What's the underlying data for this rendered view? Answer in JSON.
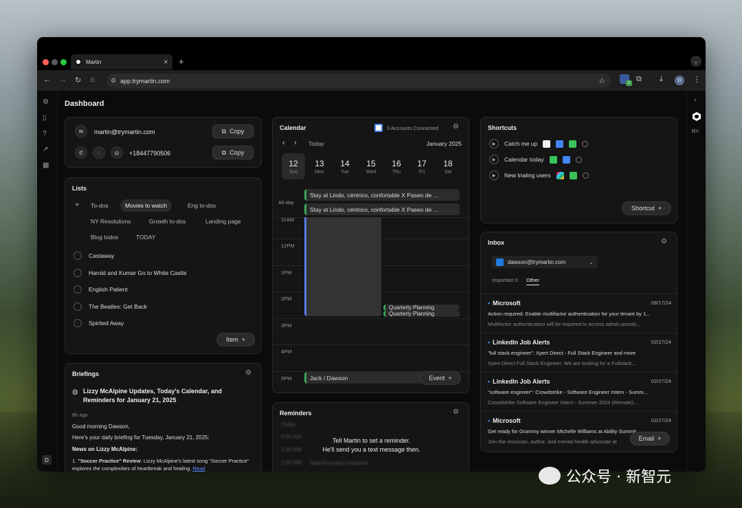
{
  "browser": {
    "tab_title": "Martin",
    "url": "app.trymartin.com",
    "ext_badge": "2",
    "profile": "D"
  },
  "page": {
    "title": "Dashboard",
    "user_initial": "D",
    "shortcut_hint": "⌘K"
  },
  "contact": {
    "email": "martin@trymartin.com",
    "phone": "+18447790506",
    "copy_label": "Copy"
  },
  "lists": {
    "title": "Lists",
    "tabs": [
      "To-dos",
      "Movies to watch",
      "Eng to-dos",
      "NY Resolutions",
      "Growth to-dos",
      "Landing page",
      "Blog todos",
      "TODAY"
    ],
    "active_tab": "Movies to watch",
    "items": [
      "Castaway",
      "Harold and Kumar Go to White Castle",
      "English Patient",
      "The Beatles: Get Back",
      "Spirited Away"
    ],
    "add_label": "Item"
  },
  "briefings": {
    "title": "Briefings",
    "headline": "Lizzy McAlpine Updates, Today's Calendar, and Reminders for January 21, 2025",
    "time": "8h ago",
    "greeting": "Good morning Dawson,",
    "intro": "Here's your daily briefing for Tuesday, January 21, 2025:",
    "section": "News on Lizzy McAlpine:",
    "item_title": "\"Soccer Practice\" Review",
    "item_text": ": Lizzy McAlpine's latest song \"Soccer Practice\" explores the complexities of heartbreak and healing.",
    "read_link": "Read"
  },
  "calendar": {
    "title": "Calendar",
    "accounts": "3 Accounts Connected",
    "today_label": "Today",
    "month": "January 2025",
    "days": [
      {
        "num": "12",
        "wd": "Sun"
      },
      {
        "num": "13",
        "wd": "Mon"
      },
      {
        "num": "14",
        "wd": "Tue"
      },
      {
        "num": "15",
        "wd": "Wed"
      },
      {
        "num": "16",
        "wd": "Thu"
      },
      {
        "num": "17",
        "wd": "Fri"
      },
      {
        "num": "18",
        "wd": "Sat"
      }
    ],
    "all_day_label": "All-day",
    "all_day_events": [
      "Stay at Lindo, céntrico, confortable X Paseo de ...",
      "Stay at Lindo, céntrico, confortable X Paseo de ..."
    ],
    "hours": [
      "11AM",
      "12PM",
      "1PM",
      "2PM",
      "3PM",
      "4PM",
      "5PM"
    ],
    "events": [
      "Quarterly Planning",
      "Quarterly Planning",
      "Jack / Dawson"
    ],
    "add_label": "Event"
  },
  "reminders": {
    "title": "Reminders",
    "empty_line1": "Tell Martin to set a reminder.",
    "empty_line2": "He'll send you a text message then.",
    "ghost": [
      "Today",
      "9:00 AM",
      "2:30 PM",
      "5:00 PM",
      "Submit project proposal"
    ]
  },
  "shortcuts": {
    "title": "Shortcuts",
    "items": [
      "Catch me up",
      "Calendar today",
      "New trialing users"
    ],
    "add_label": "Shortcut"
  },
  "inbox": {
    "title": "Inbox",
    "account": "dawson@trymartin.com",
    "tabs": [
      "Important 0",
      "Other"
    ],
    "active_tab": "Other",
    "mails": [
      {
        "from": "Microsoft",
        "date": "08/17/24",
        "subject": "Action required: Enable multifactor authentication for your tenant by 1...",
        "preview": "Multifactor authentication will be required to access admin portals..."
      },
      {
        "from": "LinkedIn Job Alerts",
        "date": "02/27/24",
        "subject": "\"full stack engineer\": Xpert Direct - Full Stack Engineer and more",
        "preview": "Xpert Direct Full Stack Engineer: We are looking for a Fullstack..."
      },
      {
        "from": "LinkedIn Job Alerts",
        "date": "02/27/24",
        "subject": "\"software engineer\": Crowdstrike - Software Engineer Intern - Summ...",
        "preview": "Crowdstrike Software Engineer Intern - Summer 2024 (Remote):..."
      },
      {
        "from": "Microsoft",
        "date": "02/27/24",
        "subject": "Get ready for Grammy winner Michelle Williams at Ability Summit",
        "preview": "Join the musician, author, and mental health advocate at"
      }
    ],
    "add_label": "Email"
  },
  "watermark": "公众号 · 新智元"
}
